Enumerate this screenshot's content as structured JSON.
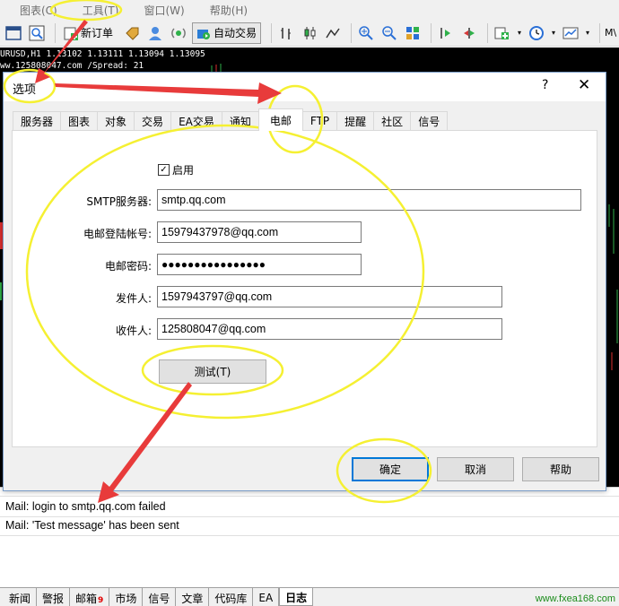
{
  "menu": {
    "items": [
      "图表(C)",
      "工具(T)",
      "窗口(W)",
      "帮助(H)"
    ]
  },
  "toolbar": {
    "new_order_label": "新订单",
    "auto_trading_label": "自动交易",
    "overflow_label": "M\\"
  },
  "chart": {
    "symbol_line": "URUSD,H1  1.13102 1.13111 1.13094 1.13095",
    "server_line": "ww.125808047.com /Spread:    21"
  },
  "dialog": {
    "title": "选项",
    "help_glyph": "?",
    "close_glyph": "✕",
    "tabs": [
      "服务器",
      "图表",
      "对象",
      "交易",
      "EA交易",
      "通知",
      "电邮",
      "FTP",
      "提醒",
      "社区",
      "信号"
    ],
    "active_tab": "电邮",
    "enable_label": "启用",
    "enable_checked": true,
    "fields": {
      "smtp_server": {
        "label": "SMTP服务器:",
        "value": "smtp.qq.com"
      },
      "login": {
        "label": "电邮登陆帐号:",
        "value": "15979437978@qq.com"
      },
      "password": {
        "label": "电邮密码:",
        "value": "●●●●●●●●●●●●●●●●"
      },
      "from": {
        "label": "发件人:",
        "value": "1597943797@qq.com"
      },
      "to": {
        "label": "收件人:",
        "value": "125808047@qq.com"
      }
    },
    "test_button": "测试(T)",
    "ok_button": "确定",
    "cancel_button": "取消",
    "help_button": "帮助"
  },
  "log": {
    "lines": [
      "Mail: login to smtp.qq.com failed",
      "Mail: 'Test message' has been sent"
    ]
  },
  "bottom_tabs": {
    "items": [
      "新闻",
      "警报",
      "邮箱",
      "市场",
      "信号",
      "文章",
      "代码库",
      "EA",
      "日志"
    ],
    "mail_badge": "9",
    "active": "日志"
  },
  "watermark": "www.fxea168.com",
  "colors": {
    "annotation_yellow": "#f5f032",
    "annotation_red": "#e83b3b",
    "primary_button_border": "#0078d7",
    "chart_background": "#000000"
  }
}
